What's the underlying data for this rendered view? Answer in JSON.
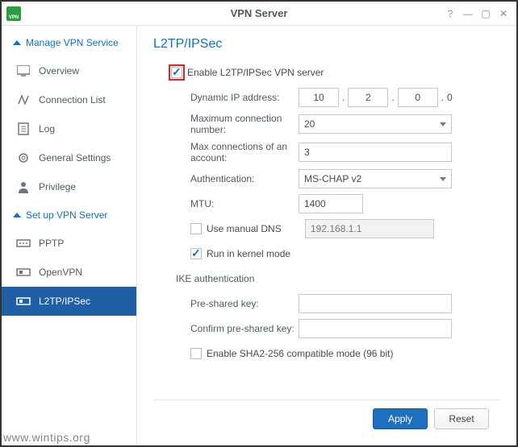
{
  "window": {
    "title": "VPN Server"
  },
  "sidebar": {
    "sections": [
      {
        "label": "Manage VPN Service"
      },
      {
        "label": "Set up VPN Server"
      }
    ],
    "items": [
      {
        "label": "Overview"
      },
      {
        "label": "Connection List"
      },
      {
        "label": "Log"
      },
      {
        "label": "General Settings"
      },
      {
        "label": "Privilege"
      },
      {
        "label": "PPTP"
      },
      {
        "label": "OpenVPN"
      },
      {
        "label": "L2TP/IPSec"
      }
    ]
  },
  "page": {
    "heading": "L2TP/IPSec",
    "enable_label": "Enable L2TP/IPSec VPN server",
    "dynamic_ip_label": "Dynamic IP address:",
    "max_conn_label": "Maximum connection number:",
    "max_acct_label": "Max connections of an account:",
    "auth_label": "Authentication:",
    "mtu_label": "MTU:",
    "manual_dns_label": "Use manual DNS",
    "kernel_label": "Run in kernel mode",
    "ike_label": "IKE authentication",
    "psk_label": "Pre-shared key:",
    "psk2_label": "Confirm pre-shared key:",
    "sha2_label": "Enable SHA2-256 compatible mode (96 bit)"
  },
  "values": {
    "enable": true,
    "ip1": "10",
    "ip2": "2",
    "ip3": "0",
    "ip4": "0",
    "max_conn": "20",
    "max_acct": "3",
    "auth": "MS-CHAP v2",
    "mtu": "1400",
    "manual_dns": false,
    "dns_placeholder": "192.168.1.1",
    "kernel": true,
    "psk": "",
    "psk2": "",
    "sha2": false
  },
  "buttons": {
    "apply": "Apply",
    "reset": "Reset"
  },
  "watermark": "www.wintips.org"
}
